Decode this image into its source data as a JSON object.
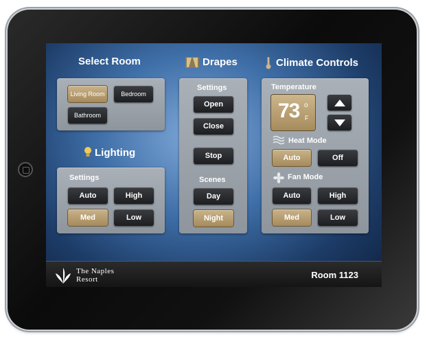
{
  "select_room": {
    "title": "Select Room",
    "rooms": [
      {
        "label": "Living Room",
        "active": true
      },
      {
        "label": "Bedroom",
        "active": false
      },
      {
        "label": "Bathroom",
        "active": false
      }
    ]
  },
  "lighting": {
    "title": "Lighting",
    "icon": "lightbulb-icon",
    "settings_label": "Settings",
    "buttons": [
      {
        "label": "Auto",
        "active": false
      },
      {
        "label": "High",
        "active": false
      },
      {
        "label": "Med",
        "active": true
      },
      {
        "label": "Low",
        "active": false
      }
    ]
  },
  "drapes": {
    "title": "Drapes",
    "icon": "drapes-icon",
    "settings_label": "Settings",
    "buttons": {
      "open": "Open",
      "close": "Close",
      "stop": "Stop"
    },
    "scenes_label": "Scenes",
    "scenes": [
      {
        "label": "Day",
        "active": false
      },
      {
        "label": "Night",
        "active": true
      }
    ]
  },
  "climate": {
    "title": "Climate Controls",
    "icon": "thermometer-icon",
    "temperature_label": "Temperature",
    "temperature_value": "73",
    "temperature_degree": "o",
    "temperature_unit": "F",
    "heat_mode_label": "Heat Mode",
    "heat_mode_icon": "heat-waves-icon",
    "heat_mode": [
      {
        "label": "Auto",
        "active": true
      },
      {
        "label": "Off",
        "active": false
      }
    ],
    "fan_mode_label": "Fan Mode",
    "fan_mode_icon": "fan-icon",
    "fan_mode": [
      {
        "label": "Auto",
        "active": false
      },
      {
        "label": "High",
        "active": false
      },
      {
        "label": "Med",
        "active": true
      },
      {
        "label": "Low",
        "active": false
      }
    ]
  },
  "footer": {
    "brand_line1": "The Naples",
    "brand_line2": "Resort",
    "room_number": "Room 1123"
  },
  "colors": {
    "accent_gold": "#b99d6e",
    "button_dark": "#2a2b2e",
    "panel_gray": "#9aa1a9"
  }
}
